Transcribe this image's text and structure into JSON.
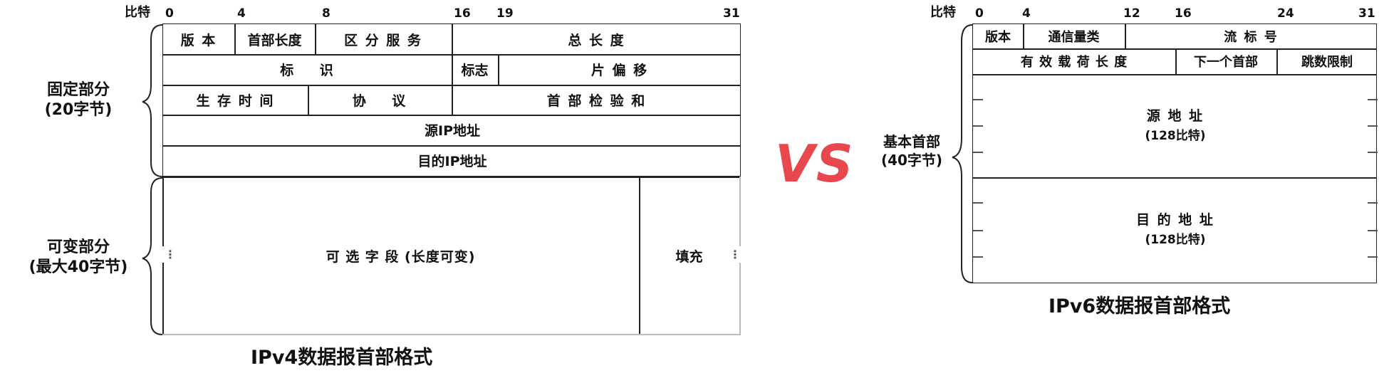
{
  "ipv4": {
    "bit_label": "比特",
    "bits": [
      "0",
      "4",
      "8",
      "16",
      "19",
      "31"
    ],
    "fields": {
      "version": "版 本",
      "header_length": "首部长度",
      "diff_services": "区 分 服 务",
      "total_length": "总 长 度",
      "identification": "标    识",
      "flags": "标志",
      "fragment_offset": "片 偏 移",
      "ttl": "生 存 时 间",
      "protocol": "协    议",
      "checksum": "首 部 检 验 和",
      "src_addr": "源IP地址",
      "dst_addr": "目的IP地址",
      "options": "可 选 字 段 (长度可变)",
      "padding": "填充"
    },
    "fixed_part": [
      "固定部分",
      "(20字节)"
    ],
    "variable_part": [
      "可变部分",
      "(最大40字节)"
    ],
    "dots_left": "⋮",
    "dots_right": "⋮",
    "caption": "IPv4数据报首部格式"
  },
  "vs": "VS",
  "ipv6": {
    "bit_label": "比特",
    "bits": [
      "0",
      "4",
      "12",
      "16",
      "24",
      "31"
    ],
    "fields": {
      "version": "版本",
      "traffic_class": "通信量类",
      "flow_label": "流 标 号",
      "payload_length": "有 效 载 荷 长 度",
      "next_header": "下一个首部",
      "hop_limit": "跳数限制",
      "src_addr": "源 地 址",
      "src_bits": "(128比特)",
      "dst_addr": "目 的 地 址",
      "dst_bits": "(128比特)"
    },
    "base_header": [
      "基本首部",
      "(40字节)"
    ],
    "caption": "IPv6数据报首部格式"
  }
}
